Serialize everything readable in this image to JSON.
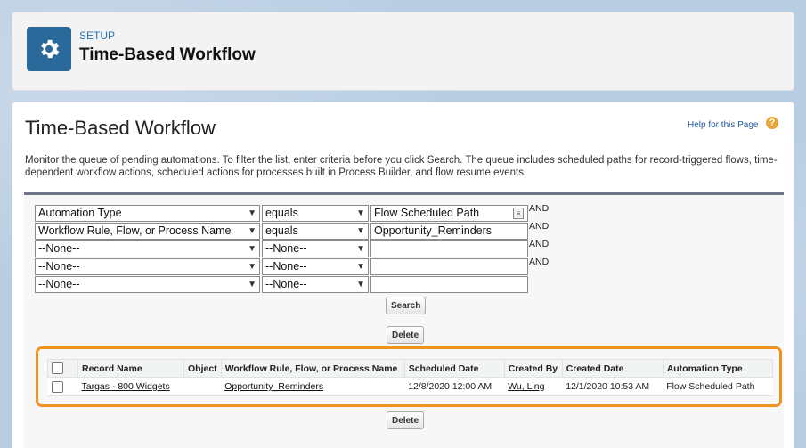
{
  "header": {
    "setup_label": "SETUP",
    "title": "Time-Based Workflow",
    "icon": "gear-icon"
  },
  "main": {
    "title": "Time-Based Workflow",
    "help_link": "Help for this Page",
    "help_icon": "?",
    "description": "Monitor the queue of pending automations. To filter the list, enter criteria before you click Search. The queue includes scheduled paths for record-triggered flows, time-dependent workflow actions, scheduled actions for processes built in Process Builder, and flow resume events."
  },
  "filters": [
    {
      "field": "Automation Type",
      "operator": "equals",
      "value": "Flow Scheduled Path",
      "connector": "AND"
    },
    {
      "field": "Workflow Rule, Flow, or Process Name",
      "operator": "equals",
      "value": "Opportunity_Reminders",
      "connector": "AND"
    },
    {
      "field": "--None--",
      "operator": "--None--",
      "value": "",
      "connector": "AND"
    },
    {
      "field": "--None--",
      "operator": "--None--",
      "value": "",
      "connector": "AND"
    },
    {
      "field": "--None--",
      "operator": "--None--",
      "value": "",
      "connector": ""
    }
  ],
  "buttons": {
    "search": "Search",
    "delete_top": "Delete",
    "delete_bottom": "Delete"
  },
  "table": {
    "headers": [
      "Record Name",
      "Object",
      "Workflow Rule, Flow, or Process Name",
      "Scheduled Date",
      "Created By",
      "Created Date",
      "Automation Type"
    ],
    "rows": [
      {
        "record_name": "Targas - 800 Widgets",
        "object": "",
        "workflow_name": "Opportunity_Reminders",
        "scheduled_date": "12/8/2020 12:00 AM",
        "created_by": "Wu, Ling",
        "created_date": "12/1/2020 10:53 AM",
        "automation_type": "Flow Scheduled Path"
      }
    ]
  },
  "colors": {
    "accent": "#2a6a9a",
    "highlight": "#f0921e",
    "link": "#2774b5"
  }
}
